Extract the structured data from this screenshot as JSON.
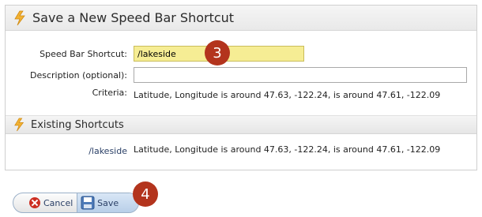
{
  "panel": {
    "title": "Save a New Speed Bar Shortcut",
    "icon": "lightning-bolt-icon"
  },
  "form": {
    "shortcut_label": "Speed Bar Shortcut:",
    "shortcut_value": "/lakeside",
    "description_label": "Description (optional):",
    "description_value": "",
    "criteria_label": "Criteria:",
    "criteria_value": "Latitude, Longitude is around 47.63, -122.24, is around 47.61, -122.09"
  },
  "existing": {
    "title": "Existing Shortcuts",
    "items": [
      {
        "name": "/lakeside",
        "criteria": "Latitude, Longitude is around 47.63, -122.24, is around 47.61, -122.09"
      }
    ]
  },
  "buttons": {
    "cancel_label": "Cancel",
    "save_label": "Save"
  },
  "badges": {
    "step_3": "3",
    "step_4": "4"
  },
  "colors": {
    "bolt": "#f2b233",
    "badge": "#b3341d",
    "input_highlight": "#f6ed94",
    "cancel_icon": "#cc2e22"
  }
}
